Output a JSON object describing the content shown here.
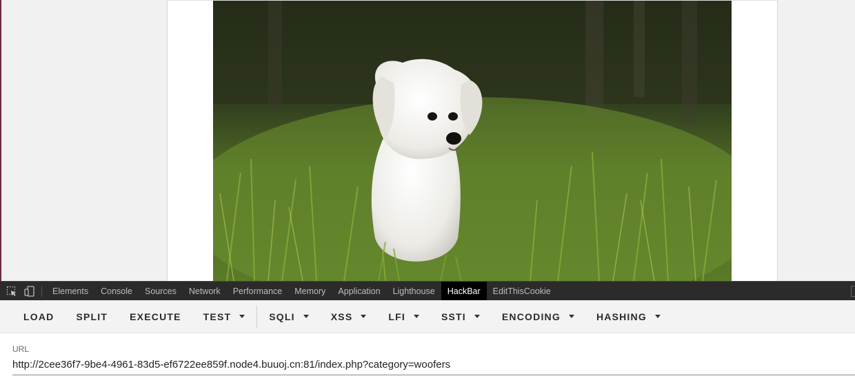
{
  "devtools": {
    "tabs": [
      {
        "label": "Elements"
      },
      {
        "label": "Console"
      },
      {
        "label": "Sources"
      },
      {
        "label": "Network"
      },
      {
        "label": "Performance"
      },
      {
        "label": "Memory"
      },
      {
        "label": "Application"
      },
      {
        "label": "Lighthouse"
      },
      {
        "label": "HackBar",
        "active": true
      },
      {
        "label": "EditThisCookie"
      }
    ],
    "icons": [
      "inspect-element-icon",
      "device-toolbar-icon"
    ]
  },
  "hackbar": {
    "buttons": [
      {
        "label": "LOAD",
        "dropdown": false
      },
      {
        "label": "SPLIT",
        "dropdown": false
      },
      {
        "label": "EXECUTE",
        "dropdown": false
      },
      {
        "label": "TEST",
        "dropdown": true
      },
      {
        "label": "SQLI",
        "dropdown": true
      },
      {
        "label": "XSS",
        "dropdown": true
      },
      {
        "label": "LFI",
        "dropdown": true
      },
      {
        "label": "SSTI",
        "dropdown": true
      },
      {
        "label": "ENCODING",
        "dropdown": true
      },
      {
        "label": "HASHING",
        "dropdown": true
      }
    ],
    "url_label": "URL",
    "url_value": "http://2cee36f7-9be4-4961-83d5-ef6722ee859f.node4.buuoj.cn:81/index.php?category=woofers"
  },
  "colors": {
    "devtools_bg": "#2b2b2b",
    "active_tab_bg": "#000000",
    "toolbar_bg": "#f3f3f3"
  }
}
